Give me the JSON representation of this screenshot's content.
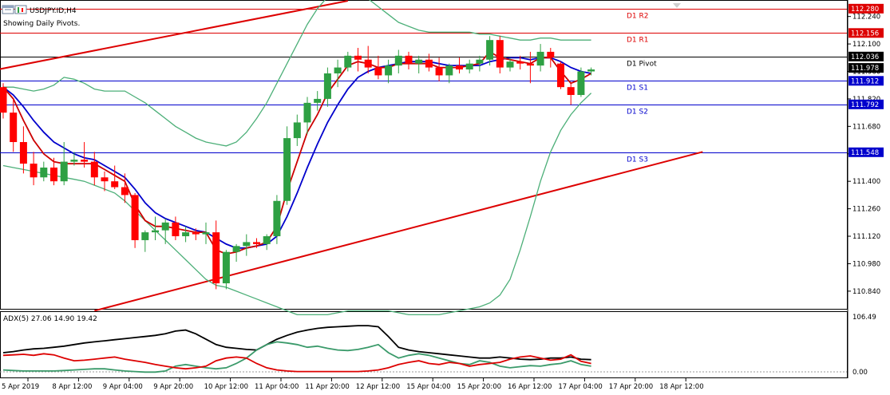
{
  "header": {
    "symbol_label": "USDJPY.ID,H4",
    "info_text": "Showing Daily Pivots."
  },
  "colors": {
    "bull": "#2ea043",
    "bear": "#ff0000",
    "bollinger": "#4caf78",
    "ma_fast": "#cc0000",
    "ma_slow": "#0000cc",
    "trendline": "#dd0000",
    "adx_main": "#000000",
    "adx_plus": "#3a9a6a",
    "adx_minus": "#dd0000"
  },
  "chart_data": [
    {
      "type": "candlestick",
      "title": "USDJPY.ID,H4",
      "subtitle": "Showing Daily Pivots.",
      "ylim": [
        110.75,
        112.32
      ],
      "y_ticks": [
        "112.240",
        "112.100",
        "111.960",
        "111.820",
        "111.680",
        "111.540",
        "111.400",
        "111.260",
        "111.120",
        "110.980",
        "110.840"
      ],
      "x_ticks": [
        "5 Apr 2019",
        "8 Apr 12:00",
        "9 Apr 04:00",
        "9 Apr 20:00",
        "10 Apr 12:00",
        "11 Apr 04:00",
        "11 Apr 20:00",
        "12 Apr 12:00",
        "15 Apr 04:00",
        "15 Apr 20:00",
        "16 Apr 12:00",
        "17 Apr 04:00",
        "17 Apr 20:00",
        "18 Apr 12:00"
      ],
      "pivot_levels": [
        {
          "name": "D1 R2",
          "value": 112.28,
          "value_label": "112.280",
          "color": "#dd0000"
        },
        {
          "name": "D1 R1",
          "value": 112.156,
          "value_label": "112.156",
          "color": "#dd0000"
        },
        {
          "name": "D1 Pivot",
          "value": 112.036,
          "value_label": "112.036",
          "color": "#000000"
        },
        {
          "name": "D1 S1",
          "value": 111.912,
          "value_label": "111.912",
          "color": "#0000cc"
        },
        {
          "name": "D1 S2",
          "value": 111.792,
          "value_label": "111.792",
          "color": "#0000cc"
        },
        {
          "name": "D1 S3",
          "value": 111.548,
          "value_label": "111.548",
          "color": "#0000cc"
        }
      ],
      "price_tags": [
        {
          "value": 111.978,
          "value_label": "111.978",
          "color": "#000000"
        }
      ],
      "candles": [
        {
          "o": 111.88,
          "h": 111.9,
          "l": 111.72,
          "c": 111.75
        },
        {
          "o": 111.75,
          "h": 111.82,
          "l": 111.55,
          "c": 111.6
        },
        {
          "o": 111.6,
          "h": 111.68,
          "l": 111.44,
          "c": 111.49
        },
        {
          "o": 111.49,
          "h": 111.55,
          "l": 111.38,
          "c": 111.42
        },
        {
          "o": 111.42,
          "h": 111.5,
          "l": 111.4,
          "c": 111.47
        },
        {
          "o": 111.47,
          "h": 111.52,
          "l": 111.38,
          "c": 111.4
        },
        {
          "o": 111.4,
          "h": 111.6,
          "l": 111.38,
          "c": 111.5
        },
        {
          "o": 111.5,
          "h": 111.55,
          "l": 111.48,
          "c": 111.51
        },
        {
          "o": 111.51,
          "h": 111.6,
          "l": 111.47,
          "c": 111.5
        },
        {
          "o": 111.5,
          "h": 111.55,
          "l": 111.38,
          "c": 111.42
        },
        {
          "o": 111.42,
          "h": 111.45,
          "l": 111.35,
          "c": 111.4
        },
        {
          "o": 111.4,
          "h": 111.48,
          "l": 111.36,
          "c": 111.37
        },
        {
          "o": 111.37,
          "h": 111.44,
          "l": 111.29,
          "c": 111.33
        },
        {
          "o": 111.33,
          "h": 111.34,
          "l": 111.06,
          "c": 111.1
        },
        {
          "o": 111.1,
          "h": 111.15,
          "l": 111.04,
          "c": 111.14
        },
        {
          "o": 111.14,
          "h": 111.22,
          "l": 111.1,
          "c": 111.15
        },
        {
          "o": 111.15,
          "h": 111.21,
          "l": 111.08,
          "c": 111.19
        },
        {
          "o": 111.19,
          "h": 111.22,
          "l": 111.1,
          "c": 111.12
        },
        {
          "o": 111.12,
          "h": 111.17,
          "l": 111.09,
          "c": 111.14
        },
        {
          "o": 111.14,
          "h": 111.16,
          "l": 111.1,
          "c": 111.13
        },
        {
          "o": 111.13,
          "h": 111.19,
          "l": 111.08,
          "c": 111.14
        },
        {
          "o": 111.14,
          "h": 111.2,
          "l": 110.85,
          "c": 110.88
        },
        {
          "o": 110.88,
          "h": 111.05,
          "l": 110.85,
          "c": 111.04
        },
        {
          "o": 111.04,
          "h": 111.08,
          "l": 110.99,
          "c": 111.07
        },
        {
          "o": 111.07,
          "h": 111.13,
          "l": 111.02,
          "c": 111.09
        },
        {
          "o": 111.09,
          "h": 111.11,
          "l": 111.06,
          "c": 111.08
        },
        {
          "o": 111.08,
          "h": 111.13,
          "l": 111.05,
          "c": 111.12
        },
        {
          "o": 111.12,
          "h": 111.33,
          "l": 111.08,
          "c": 111.3
        },
        {
          "o": 111.3,
          "h": 111.68,
          "l": 111.28,
          "c": 111.62
        },
        {
          "o": 111.62,
          "h": 111.74,
          "l": 111.58,
          "c": 111.7
        },
        {
          "o": 111.7,
          "h": 111.83,
          "l": 111.64,
          "c": 111.8
        },
        {
          "o": 111.8,
          "h": 111.86,
          "l": 111.76,
          "c": 111.82
        },
        {
          "o": 111.82,
          "h": 111.98,
          "l": 111.78,
          "c": 111.95
        },
        {
          "o": 111.95,
          "h": 112.02,
          "l": 111.88,
          "c": 111.98
        },
        {
          "o": 111.98,
          "h": 112.06,
          "l": 111.96,
          "c": 112.04
        },
        {
          "o": 112.04,
          "h": 112.08,
          "l": 111.96,
          "c": 112.02
        },
        {
          "o": 112.02,
          "h": 112.09,
          "l": 111.95,
          "c": 111.98
        },
        {
          "o": 111.98,
          "h": 112.04,
          "l": 111.92,
          "c": 111.94
        },
        {
          "o": 111.94,
          "h": 112.02,
          "l": 111.9,
          "c": 111.99
        },
        {
          "o": 111.99,
          "h": 112.07,
          "l": 111.95,
          "c": 112.04
        },
        {
          "o": 112.04,
          "h": 112.06,
          "l": 111.97,
          "c": 112.0
        },
        {
          "o": 112.0,
          "h": 112.04,
          "l": 111.95,
          "c": 112.02
        },
        {
          "o": 112.02,
          "h": 112.05,
          "l": 111.96,
          "c": 111.98
        },
        {
          "o": 111.98,
          "h": 112.03,
          "l": 111.91,
          "c": 111.94
        },
        {
          "o": 111.94,
          "h": 112.0,
          "l": 111.9,
          "c": 111.99
        },
        {
          "o": 111.99,
          "h": 112.03,
          "l": 111.95,
          "c": 111.97
        },
        {
          "o": 111.97,
          "h": 112.02,
          "l": 111.95,
          "c": 112.0
        },
        {
          "o": 112.0,
          "h": 112.04,
          "l": 111.96,
          "c": 112.02
        },
        {
          "o": 112.02,
          "h": 112.14,
          "l": 111.99,
          "c": 112.12
        },
        {
          "o": 112.12,
          "h": 112.14,
          "l": 111.95,
          "c": 111.98
        },
        {
          "o": 111.98,
          "h": 112.03,
          "l": 111.96,
          "c": 112.01
        },
        {
          "o": 112.01,
          "h": 112.04,
          "l": 111.97,
          "c": 112.0
        },
        {
          "o": 112.0,
          "h": 112.06,
          "l": 111.9,
          "c": 111.99
        },
        {
          "o": 111.99,
          "h": 112.1,
          "l": 111.96,
          "c": 112.06
        },
        {
          "o": 112.06,
          "h": 112.08,
          "l": 111.98,
          "c": 112.03
        },
        {
          "o": 112.0,
          "h": 112.01,
          "l": 111.87,
          "c": 111.88
        },
        {
          "o": 111.88,
          "h": 111.9,
          "l": 111.79,
          "c": 111.84
        },
        {
          "o": 111.84,
          "h": 111.98,
          "l": 111.83,
          "c": 111.96
        },
        {
          "o": 111.96,
          "h": 111.98,
          "l": 111.94,
          "c": 111.97
        }
      ],
      "bollinger_upper": [
        111.88,
        111.88,
        111.87,
        111.86,
        111.87,
        111.89,
        111.93,
        111.92,
        111.9,
        111.87,
        111.86,
        111.86,
        111.86,
        111.83,
        111.8,
        111.76,
        111.72,
        111.68,
        111.65,
        111.62,
        111.6,
        111.59,
        111.58,
        111.6,
        111.65,
        111.72,
        111.8,
        111.9,
        112.0,
        112.1,
        112.2,
        112.28,
        112.34,
        112.38,
        112.38,
        112.36,
        112.33,
        112.29,
        112.25,
        112.21,
        112.19,
        112.17,
        112.16,
        112.16,
        112.16,
        112.16,
        112.16,
        112.15,
        112.15,
        112.14,
        112.13,
        112.12,
        112.12,
        112.13,
        112.13,
        112.12,
        112.12,
        112.12,
        112.12
      ],
      "bollinger_lower": [
        111.48,
        111.47,
        111.46,
        111.45,
        111.44,
        111.43,
        111.42,
        111.41,
        111.4,
        111.38,
        111.36,
        111.34,
        111.3,
        111.25,
        111.2,
        111.15,
        111.1,
        111.05,
        111.0,
        110.95,
        110.9,
        110.87,
        110.86,
        110.84,
        110.82,
        110.8,
        110.78,
        110.76,
        110.74,
        110.72,
        110.72,
        110.72,
        110.72,
        110.73,
        110.74,
        110.74,
        110.74,
        110.74,
        110.74,
        110.73,
        110.72,
        110.72,
        110.72,
        110.72,
        110.73,
        110.74,
        110.75,
        110.76,
        110.78,
        110.82,
        110.9,
        111.05,
        111.22,
        111.4,
        111.55,
        111.66,
        111.74,
        111.8,
        111.85
      ],
      "ma_fast": [
        111.88,
        111.82,
        111.71,
        111.61,
        111.54,
        111.5,
        111.49,
        111.49,
        111.49,
        111.49,
        111.46,
        111.43,
        111.4,
        111.28,
        111.2,
        111.17,
        111.17,
        111.16,
        111.15,
        111.14,
        111.14,
        111.05,
        111.03,
        111.04,
        111.06,
        111.07,
        111.09,
        111.17,
        111.35,
        111.5,
        111.65,
        111.74,
        111.85,
        111.92,
        111.99,
        112.01,
        112.0,
        111.98,
        111.98,
        112.0,
        112.0,
        112.0,
        112.0,
        111.98,
        111.98,
        111.98,
        111.99,
        112.0,
        112.06,
        112.03,
        112.02,
        112.01,
        112.0,
        112.03,
        112.03,
        111.96,
        111.9,
        111.92,
        111.95
      ],
      "ma_slow": [
        111.88,
        111.84,
        111.78,
        111.71,
        111.65,
        111.6,
        111.57,
        111.54,
        111.52,
        111.51,
        111.48,
        111.45,
        111.42,
        111.36,
        111.29,
        111.24,
        111.21,
        111.19,
        111.17,
        111.15,
        111.14,
        111.11,
        111.08,
        111.06,
        111.06,
        111.07,
        111.08,
        111.12,
        111.22,
        111.34,
        111.47,
        111.59,
        111.7,
        111.79,
        111.87,
        111.93,
        111.96,
        111.98,
        111.99,
        112.0,
        112.01,
        112.01,
        112.01,
        112.0,
        111.99,
        111.99,
        111.99,
        111.99,
        112.01,
        112.02,
        112.03,
        112.03,
        112.02,
        112.03,
        112.03,
        112.01,
        111.98,
        111.96,
        111.95
      ],
      "trendlines": [
        {
          "from": {
            "bar": -1.5,
            "value": 111.96
          },
          "to": {
            "bar": 34,
            "value": 112.32
          }
        },
        {
          "from": {
            "bar": 9,
            "value": 110.74
          },
          "to": {
            "bar": 69,
            "value": 111.55
          }
        }
      ]
    },
    {
      "type": "line",
      "title": "ADX(5) 27.06 14.90 19.42",
      "ylim": [
        0,
        106.49
      ],
      "y_ticks": [
        "106.49",
        "0.00"
      ],
      "series": [
        {
          "name": "ADX",
          "color": "#000000",
          "values": [
            40,
            42,
            45,
            47,
            48,
            50,
            52,
            55,
            58,
            60,
            62,
            64,
            66,
            68,
            70,
            72,
            75,
            80,
            82,
            75,
            65,
            55,
            50,
            48,
            46,
            45,
            55,
            65,
            72,
            78,
            82,
            85,
            87,
            88,
            89,
            90,
            90,
            88,
            70,
            50,
            45,
            42,
            40,
            38,
            36,
            34,
            32,
            30,
            30,
            32,
            30,
            28,
            27,
            28,
            30,
            30,
            32,
            28,
            27
          ]
        },
        {
          "name": "+DI",
          "color": "#3a9a6a",
          "values": [
            8,
            7,
            6,
            6,
            6,
            6,
            7,
            8,
            9,
            10,
            10,
            8,
            6,
            5,
            4,
            4,
            6,
            15,
            18,
            15,
            12,
            10,
            12,
            20,
            30,
            45,
            55,
            60,
            58,
            55,
            50,
            52,
            48,
            45,
            44,
            46,
            50,
            55,
            40,
            30,
            35,
            38,
            35,
            30,
            25,
            20,
            18,
            25,
            22,
            15,
            12,
            14,
            16,
            15,
            18,
            20,
            25,
            18,
            15
          ]
        },
        {
          "name": "-DI",
          "color": "#dd0000",
          "values": [
            35,
            36,
            37,
            35,
            38,
            36,
            30,
            25,
            26,
            28,
            30,
            32,
            28,
            25,
            22,
            18,
            15,
            12,
            10,
            12,
            15,
            25,
            30,
            32,
            30,
            20,
            12,
            8,
            6,
            5,
            5,
            5,
            5,
            5,
            5,
            5,
            6,
            8,
            12,
            18,
            22,
            25,
            20,
            18,
            22,
            20,
            15,
            18,
            20,
            22,
            28,
            32,
            34,
            30,
            26,
            28,
            36,
            24,
            20
          ]
        }
      ]
    }
  ]
}
